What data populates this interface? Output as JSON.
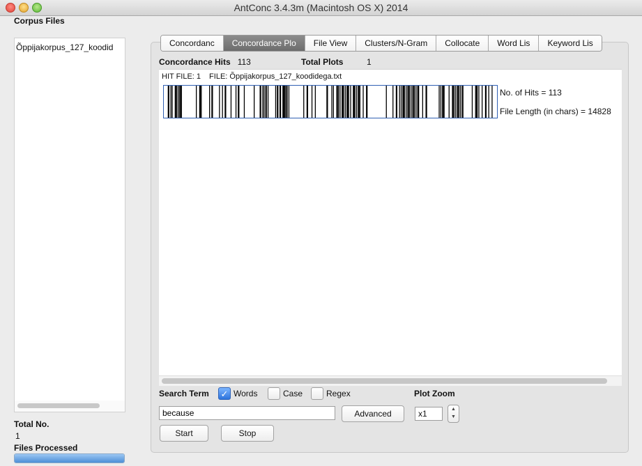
{
  "window": {
    "title": "AntConc 3.4.3m (Macintosh OS X) 2014"
  },
  "left_panel": {
    "title": "Corpus Files",
    "files": [
      "Õppijakorpus_127_koodid"
    ],
    "total_label": "Total No.",
    "total_value": "1",
    "processed_label": "Files Processed",
    "progress": 1.0
  },
  "tabs": [
    {
      "label": "Concordanc",
      "active": false
    },
    {
      "label": "Concordance Plo",
      "active": true
    },
    {
      "label": "File View",
      "active": false
    },
    {
      "label": "Clusters/N-Gram",
      "active": false
    },
    {
      "label": "Collocate",
      "active": false
    },
    {
      "label": "Word Lis",
      "active": false
    },
    {
      "label": "Keyword Lis",
      "active": false
    }
  ],
  "summary": {
    "hits_label": "Concordance Hits",
    "hits_value": "113",
    "plots_label": "Total Plots",
    "plots_value": "1"
  },
  "plot": {
    "hit_file": "HIT FILE: 1",
    "file_name": "FILE: Õppijakorpus_127_koodidega.txt",
    "no_of_hits": "No. of Hits = 113",
    "file_length": "File Length (in chars) = 14828",
    "hit_positions": [
      0.01,
      0.018,
      0.022,
      0.031,
      0.036,
      0.041,
      0.045,
      0.05,
      0.095,
      0.105,
      0.11,
      0.135,
      0.142,
      0.165,
      0.174,
      0.182,
      0.2,
      0.215,
      0.222,
      0.24,
      0.27,
      0.288,
      0.296,
      0.3,
      0.305,
      0.312,
      0.335,
      0.34,
      0.348,
      0.35,
      0.357,
      0.361,
      0.364,
      0.368,
      0.375,
      0.42,
      0.43,
      0.445,
      0.455,
      0.49,
      0.505,
      0.51,
      0.52,
      0.525,
      0.53,
      0.536,
      0.541,
      0.546,
      0.551,
      0.556,
      0.562,
      0.57,
      0.575,
      0.58,
      0.585,
      0.59,
      0.6,
      0.61,
      0.67,
      0.69,
      0.7,
      0.71,
      0.715,
      0.72,
      0.725,
      0.73,
      0.735,
      0.74,
      0.745,
      0.75,
      0.755,
      0.76,
      0.765,
      0.768,
      0.78,
      0.79,
      0.83,
      0.835,
      0.84,
      0.845,
      0.86,
      0.87,
      0.875,
      0.88,
      0.885,
      0.89,
      0.895,
      0.9,
      0.93,
      0.94,
      0.943,
      0.95,
      0.96,
      0.97,
      0.98,
      0.99
    ]
  },
  "search": {
    "label": "Search Term",
    "words_label": "Words",
    "words_checked": true,
    "case_label": "Case",
    "case_checked": false,
    "regex_label": "Regex",
    "regex_checked": false,
    "value": "because",
    "advanced_label": "Advanced",
    "start_label": "Start",
    "stop_label": "Stop"
  },
  "zoom": {
    "label": "Plot Zoom",
    "value": "x1"
  }
}
